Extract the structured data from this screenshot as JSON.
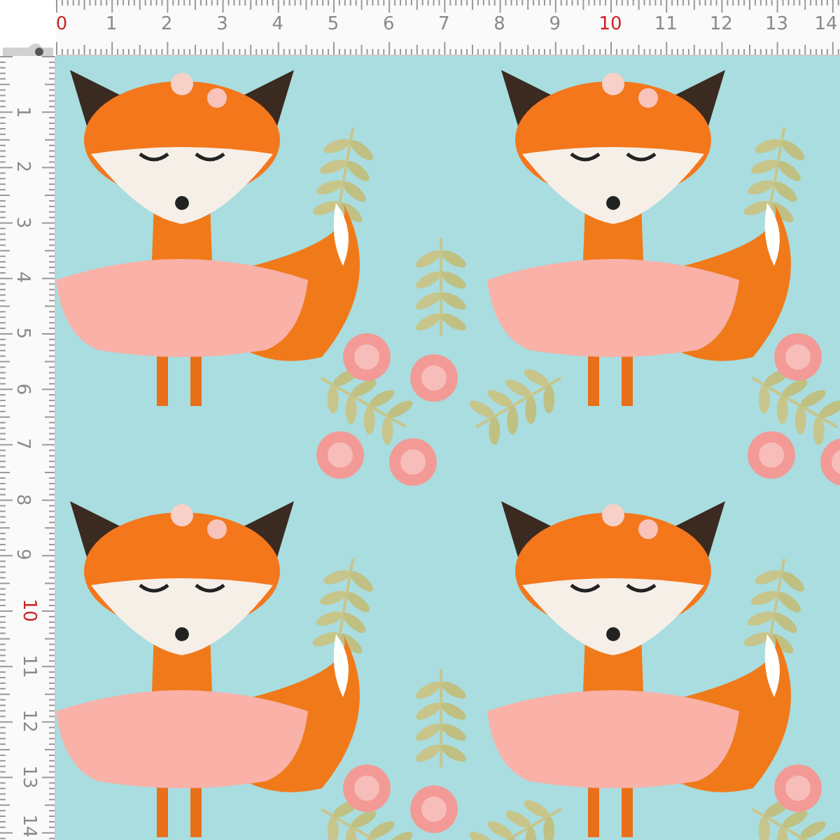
{
  "top_ruler": {
    "labels": [
      {
        "text": "0",
        "color": "#cc2222"
      },
      {
        "text": "1",
        "color": "#8a8a8a"
      },
      {
        "text": "2",
        "color": "#8a8a8a"
      },
      {
        "text": "3",
        "color": "#8a8a8a"
      },
      {
        "text": "4",
        "color": "#8a8a8a"
      },
      {
        "text": "5",
        "color": "#8a8a8a"
      },
      {
        "text": "6",
        "color": "#8a8a8a"
      },
      {
        "text": "7",
        "color": "#8a8a8a"
      },
      {
        "text": "8",
        "color": "#8a8a8a"
      },
      {
        "text": "9",
        "color": "#8a8a8a"
      },
      {
        "text": "10",
        "color": "#cc2222"
      },
      {
        "text": "11",
        "color": "#8a8a8a"
      },
      {
        "text": "12",
        "color": "#8a8a8a"
      },
      {
        "text": "13",
        "color": "#8a8a8a"
      },
      {
        "text": "14",
        "color": "#8a8a8a"
      }
    ]
  },
  "left_ruler": {
    "labels": [
      {
        "text": "1",
        "color": "#8a8a8a"
      },
      {
        "text": "2",
        "color": "#8a8a8a"
      },
      {
        "text": "3",
        "color": "#8a8a8a"
      },
      {
        "text": "4",
        "color": "#8a8a8a"
      },
      {
        "text": "5",
        "color": "#8a8a8a"
      },
      {
        "text": "6",
        "color": "#8a8a8a"
      },
      {
        "text": "7",
        "color": "#8a8a8a"
      },
      {
        "text": "8",
        "color": "#8a8a8a"
      },
      {
        "text": "9",
        "color": "#8a8a8a"
      },
      {
        "text": "10",
        "color": "#cc2222"
      },
      {
        "text": "11",
        "color": "#8a8a8a"
      },
      {
        "text": "12",
        "color": "#8a8a8a"
      },
      {
        "text": "13",
        "color": "#8a8a8a"
      },
      {
        "text": "14",
        "color": "#8a8a8a"
      }
    ]
  }
}
